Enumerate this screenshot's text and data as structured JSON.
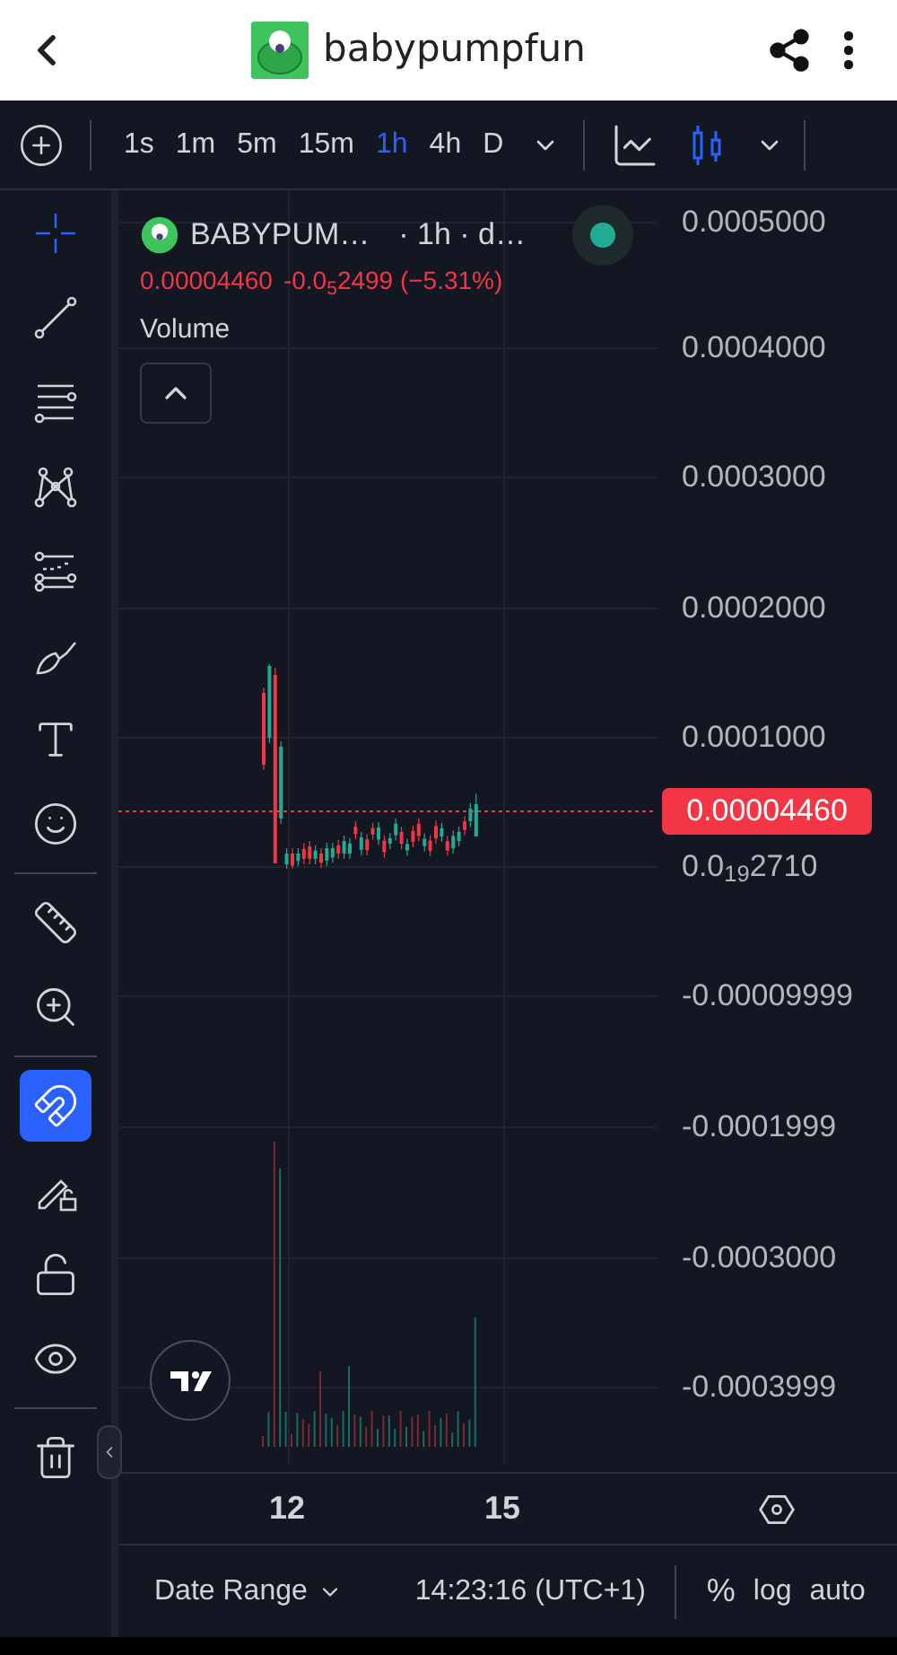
{
  "header": {
    "title": "babypumpfun"
  },
  "timeframes": [
    {
      "label": "1s",
      "selected": false
    },
    {
      "label": "1m",
      "selected": false
    },
    {
      "label": "5m",
      "selected": false
    },
    {
      "label": "15m",
      "selected": false
    },
    {
      "label": "1h",
      "selected": true
    },
    {
      "label": "4h",
      "selected": false
    },
    {
      "label": "D",
      "selected": false
    }
  ],
  "chart_types": [
    {
      "kind": "line",
      "selected": false
    },
    {
      "kind": "candles",
      "selected": true
    }
  ],
  "drawing_tools": [
    {
      "kind": "crosshair",
      "selected": true
    },
    {
      "kind": "trend-line",
      "selected": false
    },
    {
      "kind": "fib",
      "selected": false
    },
    {
      "kind": "pattern",
      "selected": false
    },
    {
      "kind": "forecast",
      "selected": false
    },
    {
      "kind": "brush",
      "selected": false
    },
    {
      "kind": "text",
      "selected": false
    },
    {
      "kind": "emoji",
      "selected": false
    }
  ],
  "measure_tools": [
    {
      "kind": "ruler"
    },
    {
      "kind": "zoom"
    }
  ],
  "mode_tools": [
    {
      "kind": "magnet",
      "on": true
    },
    {
      "kind": "lock-drawings",
      "on": false
    },
    {
      "kind": "lock",
      "on": false
    },
    {
      "kind": "hide",
      "on": false
    }
  ],
  "legend": {
    "symbol": "BABYPUM…",
    "interval": "· 1h · d…",
    "price": "0.00004460",
    "change": "-0.0$_{5}$2499 (−5.31%)",
    "volume_label": "Volume"
  },
  "price_axis": [
    {
      "kind": "tick",
      "label": "0.0005000"
    },
    {
      "kind": "tick",
      "label": "0.0004000"
    },
    {
      "kind": "tick",
      "label": "0.0003000"
    },
    {
      "kind": "tick",
      "label": "0.0002000"
    },
    {
      "kind": "tick",
      "label": "0.0001000"
    },
    {
      "kind": "current",
      "label": "0.00004460"
    },
    {
      "kind": "tick",
      "label": "0.0$_{19}$2710"
    },
    {
      "kind": "tick",
      "label": "-0.00009999"
    },
    {
      "kind": "tick",
      "label": "-0.0001999"
    },
    {
      "kind": "tick",
      "label": "-0.0003000"
    },
    {
      "kind": "tick",
      "label": "-0.0003999"
    }
  ],
  "time_axis": [
    "12",
    "15"
  ],
  "bottom_bar": {
    "date_range": "Date Range",
    "time": "14:23:16 (UTC+1)",
    "buttons": [
      "%",
      "log",
      "auto"
    ]
  }
}
